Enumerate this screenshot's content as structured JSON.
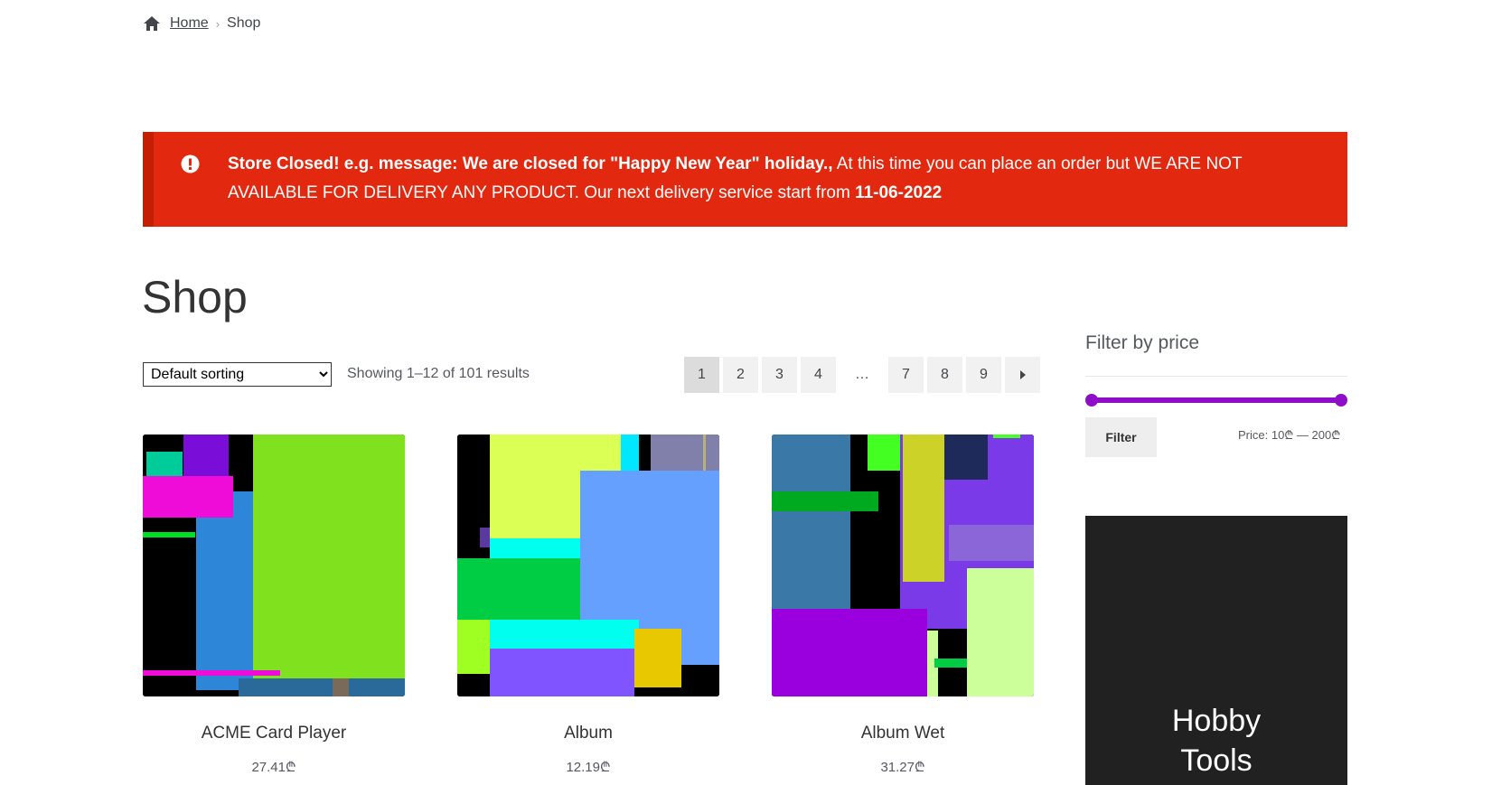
{
  "breadcrumb": {
    "home": "Home",
    "separator": "›",
    "current": "Shop"
  },
  "notice": {
    "bold": "Store Closed! e.g. message: We are closed for \"Happy New Year\" holiday.,",
    "text": " At this time you can place an order but WE ARE NOT AVAILABLE FOR DELIVERY ANY PRODUCT. Our next delivery service start from ",
    "date": "11-06-2022",
    "color": "#e2290f"
  },
  "page": {
    "title": "Shop"
  },
  "toolbar": {
    "sorting_selected": "Default sorting",
    "result_count": "Showing 1–12 of 101 results"
  },
  "pagination": {
    "pages": [
      "1",
      "2",
      "3",
      "4",
      "…",
      "7",
      "8",
      "9"
    ],
    "current": "1",
    "next_icon": "arrow-right-icon"
  },
  "products": [
    {
      "name": "ACME Card Player",
      "price": "27.41₾"
    },
    {
      "name": "Album",
      "price": "12.19₾"
    },
    {
      "name": "Album Wet",
      "price": "31.27₾"
    }
  ],
  "sidebar": {
    "filter_title": "Filter by price",
    "filter_button": "Filter",
    "price_label": "Price: 10₾ — 200₾",
    "slider_color": "#8e0dc8",
    "banner_line1": "Hobby",
    "banner_line2": "Tools"
  }
}
